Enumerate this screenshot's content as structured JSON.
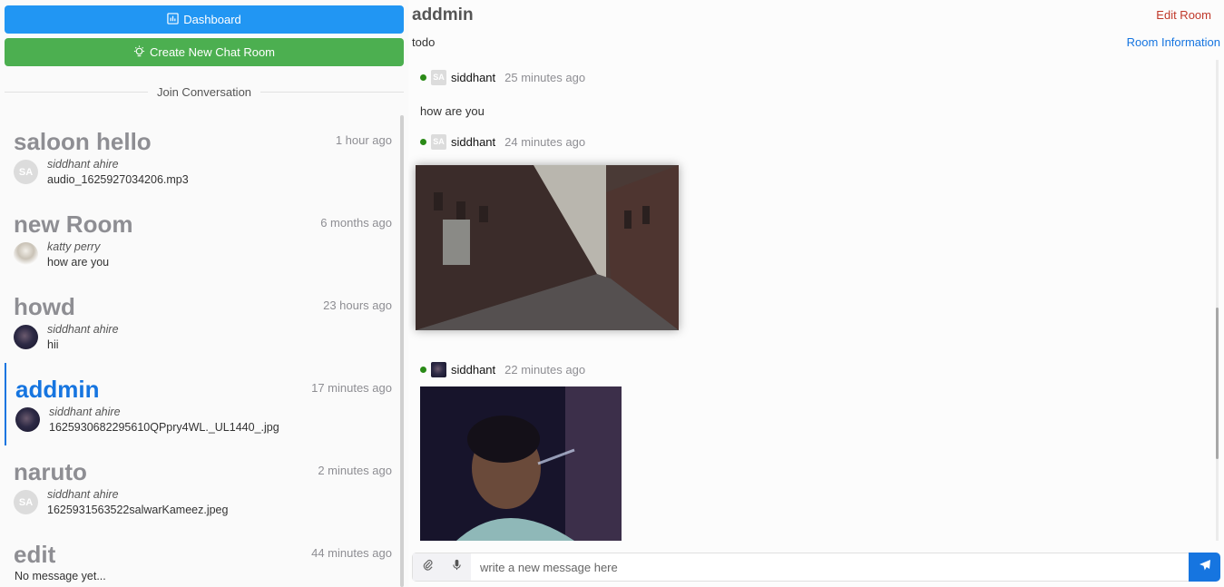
{
  "sidebar": {
    "dashboard_label": "Dashboard",
    "create_room_label": "Create New Chat Room",
    "join_label": "Join Conversation",
    "rooms": [
      {
        "name": "saloon hello",
        "time": "1 hour ago",
        "author": "siddhant ahire",
        "message": "audio_1625927034206.mp3",
        "avatar_initials": "SA"
      },
      {
        "name": "new Room",
        "time": "6 months ago",
        "author": "katty perry",
        "message": "how are you",
        "avatar_initials": ""
      },
      {
        "name": "howd",
        "time": "23 hours ago",
        "author": "siddhant ahire",
        "message": "hii",
        "avatar_initials": ""
      },
      {
        "name": "addmin",
        "time": "17 minutes ago",
        "author": "siddhant ahire",
        "message": "1625930682295610QPpry4WL._UL1440_.jpg",
        "avatar_initials": ""
      },
      {
        "name": "naruto",
        "time": "2 minutes ago",
        "author": "siddhant ahire",
        "message": "1625931563522salwarKameez.jpeg",
        "avatar_initials": "SA"
      },
      {
        "name": "edit",
        "time": "44 minutes ago",
        "empty": "No message yet..."
      }
    ]
  },
  "room": {
    "name": "addmin",
    "description": "todo",
    "edit_label": "Edit Room",
    "info_label": "Room Information"
  },
  "messages": [
    {
      "author": "siddhant",
      "time": "25 minutes ago",
      "text": "how are you",
      "avatar_initials": "SA"
    },
    {
      "author": "siddhant",
      "time": "24 minutes ago",
      "avatar_initials": "SA",
      "attachment": "street-photo"
    },
    {
      "author": "siddhant",
      "time": "22 minutes ago",
      "avatar_initials": "",
      "attachment": "portrait-photo"
    }
  ],
  "composer": {
    "placeholder": "write a new message here"
  },
  "colors": {
    "dashboard": "#2196f3",
    "create": "#4caf50",
    "accent": "#1675e0",
    "edit": "#c0392b",
    "online": "#2a8a17"
  },
  "icons": {
    "dashboard": "dashboard-icon",
    "create": "creative-icon",
    "attach": "paperclip-icon",
    "mic": "microphone-icon",
    "send": "send-icon"
  }
}
